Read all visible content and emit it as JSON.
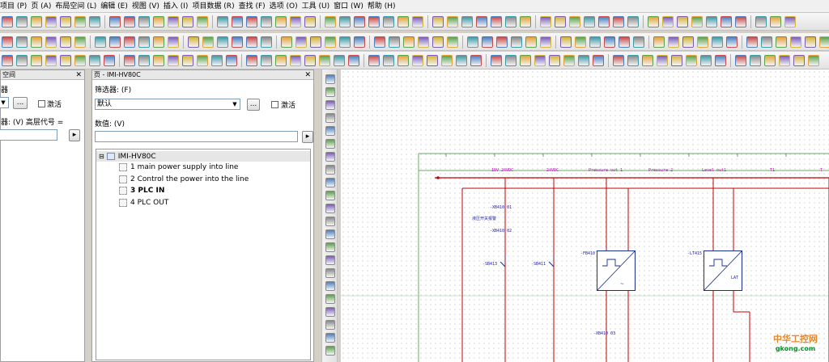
{
  "menu": [
    "项目 (P)",
    "页 (A)",
    "布局空间 (L)",
    "编辑 (E)",
    "视图 (V)",
    "插入 (I)",
    "项目数据 (R)",
    "查找 (F)",
    "选项 (O)",
    "工具 (U)",
    "窗口 (W)",
    "帮助 (H)"
  ],
  "left_panel": {
    "title": "空间",
    "filter_label": "器",
    "activate_label": "激活",
    "data_label": "器: (V) 高层代号 =",
    "more_button": "..."
  },
  "page_panel": {
    "title": "页 - IMI-HV80C",
    "filter_label": "筛选器: (F)",
    "filter_value": "默认",
    "more_button": "...",
    "activate_label": "激活",
    "data_label": "数值: (V)",
    "tree": {
      "root": "IMI-HV80C",
      "items": [
        {
          "label": "1  main power supply into line",
          "bold": false
        },
        {
          "label": "2 Control the power into the line",
          "bold": false
        },
        {
          "label": "3 PLC IN",
          "bold": true
        },
        {
          "label": "4 PLC OUT",
          "bold": false
        }
      ]
    }
  },
  "canvas": {
    "nets": [
      "10V 24VDC",
      "24VDC",
      "Pressure out 1",
      "Pressure 2",
      "Level out1",
      "T1",
      "T"
    ],
    "labels": {
      "left_note": "液压开关报警",
      "comp_a": "-FB410",
      "comp_b": "-LT415",
      "comp_b_mark": "LAT",
      "wire1": "-XB410 01",
      "wire2": "-XB410 02",
      "sw1": "-SB413",
      "sw2": "-SB411",
      "bottom": "-XB410 03"
    }
  },
  "watermark": {
    "line1": "中华工控网",
    "line2": "gkong.com"
  },
  "colors": {
    "net_pink": "#d000d0",
    "wire_red": "#c00000",
    "grid_green": "#6aa86a",
    "box_blue": "#1a2f8c"
  }
}
